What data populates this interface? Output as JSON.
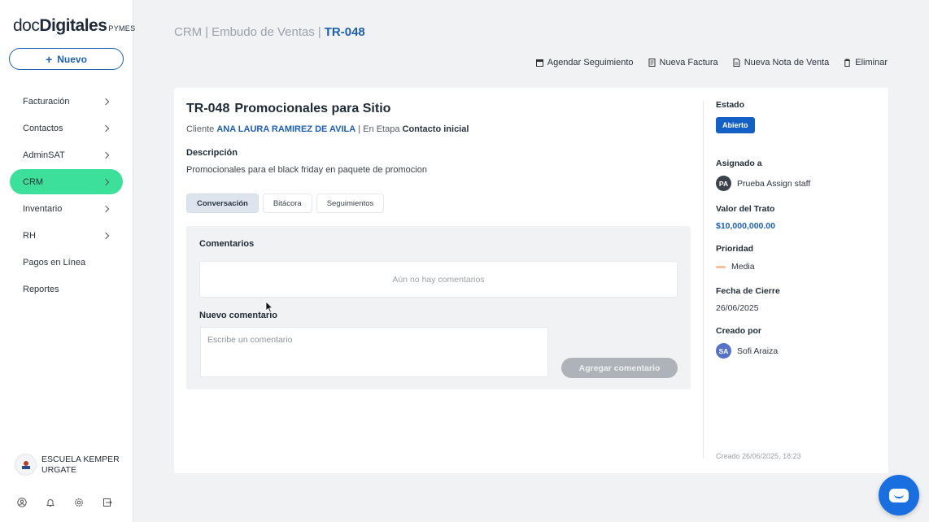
{
  "brand": {
    "doc": "doc",
    "digitales": "Digitales",
    "pymes": "PYMES"
  },
  "sidebar": {
    "new_label": "Nuevo",
    "items": [
      {
        "label": "Facturación",
        "chevron": true
      },
      {
        "label": "Contactos",
        "chevron": true
      },
      {
        "label": "AdminSAT",
        "chevron": true
      },
      {
        "label": "CRM",
        "chevron": true,
        "active": true
      },
      {
        "label": "Inventario",
        "chevron": true
      },
      {
        "label": "RH",
        "chevron": true
      },
      {
        "label": "Pagos en Línea",
        "chevron": false
      },
      {
        "label": "Reportes",
        "chevron": false
      }
    ],
    "company": "ESCUELA KEMPER URGATE",
    "bottom_icons": [
      "user-icon",
      "bell-icon",
      "gear-icon",
      "logout-icon"
    ]
  },
  "header": {
    "crumb1": "CRM",
    "crumb2": "Embudo de Ventas",
    "crumb3": "TR-048",
    "actions": [
      "Agendar Seguimiento",
      "Nueva Factura",
      "Nueva Nota de Venta",
      "Eliminar"
    ]
  },
  "deal": {
    "code": "TR-048",
    "name": "Promocionales para Sitio",
    "client_prefix": "Cliente",
    "client": "ANA LAURA RAMIREZ DE AVILA",
    "stage_prefix": "| En Etapa",
    "stage": "Contacto inicial",
    "desc_label": "Descripción",
    "desc": "Promocionales para el black friday en paquete de promocion",
    "tabs": [
      "Conversación",
      "Bitácora",
      "Seguimientos"
    ],
    "active_tab": 0,
    "comments_label": "Comentarios",
    "empty_comments": "Aún no hay comentarios",
    "new_comment_label": "Nuevo comentario",
    "comment_placeholder": "Escribe un comentario",
    "add_button": "Agregar comentario"
  },
  "details": {
    "estado_label": "Estado",
    "estado": "Abierto",
    "asignado_label": "Asignado a",
    "asignado_initials": "PA",
    "asignado": "Prueba Assign staff",
    "valor_label": "Valor del Trato",
    "valor": "$10,000,000.00",
    "prioridad_label": "Prioridad",
    "prioridad": "Media",
    "cierre_label": "Fecha de Cierre",
    "cierre": "26/06/2025",
    "creado_label": "Creado por",
    "creado_initials": "SA",
    "creado": "Sofi Araiza",
    "footer": "Creado 26/06/2025, 18:23"
  },
  "colors": {
    "accent": "#1e5fae",
    "active_nav": "#3de09a",
    "badge": "#1560c5",
    "chat": "#1a6fe0"
  }
}
